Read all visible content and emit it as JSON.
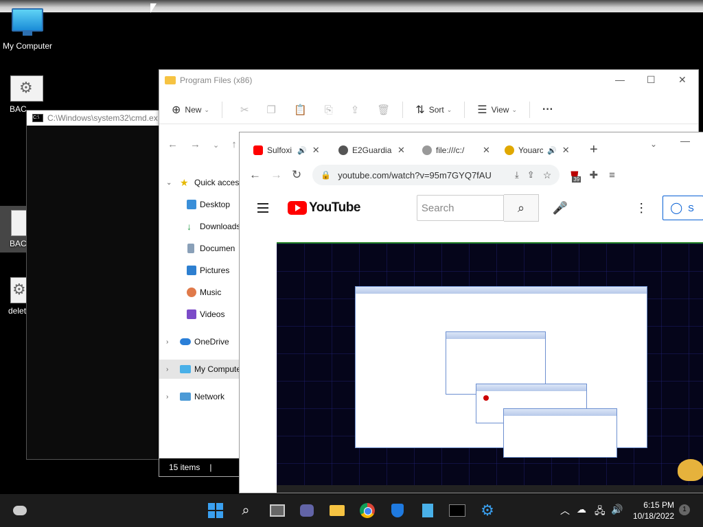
{
  "desktop": {
    "icons": [
      {
        "label": "My Computer"
      },
      {
        "label": "BAC"
      },
      {
        "label": "BAC"
      },
      {
        "label": "delet"
      }
    ]
  },
  "cmd": {
    "title": "C:\\Windows\\system32\\cmd.ex"
  },
  "explorer": {
    "title": "Program Files (x86)",
    "toolbar": {
      "new_label": "New",
      "sort_label": "Sort",
      "view_label": "View",
      "more_label": "···"
    },
    "nav_items": [
      {
        "label": "Quick access"
      },
      {
        "label": "Desktop"
      },
      {
        "label": "Downloads"
      },
      {
        "label": "Documen"
      },
      {
        "label": "Pictures"
      },
      {
        "label": "Music"
      },
      {
        "label": "Videos"
      },
      {
        "label": "OneDrive"
      },
      {
        "label": "My Compute"
      },
      {
        "label": "Network"
      }
    ],
    "status": "15 items"
  },
  "chrome": {
    "tabs": [
      {
        "title": "Sulfoxi",
        "favicon": "youtube-icon"
      },
      {
        "title": "E2Guardia",
        "favicon": "globe-icon"
      },
      {
        "title": "file:///c:/",
        "favicon": "globe-icon"
      },
      {
        "title": "Youarc",
        "favicon": "coin-icon"
      }
    ],
    "url": "youtube.com/watch?v=95m7GYQ7fAU",
    "extension_badge": "39"
  },
  "youtube": {
    "logo_text": "YouTube",
    "search_placeholder": "Search",
    "signin_label": "S"
  },
  "taskbar": {
    "time": "6:15 PM",
    "date": "10/18/2022",
    "notification_count": "1"
  },
  "colors": {
    "youtube_red": "#ff0000",
    "signin_blue": "#065fd4",
    "taskbar_bg": "#1c1c1c"
  }
}
